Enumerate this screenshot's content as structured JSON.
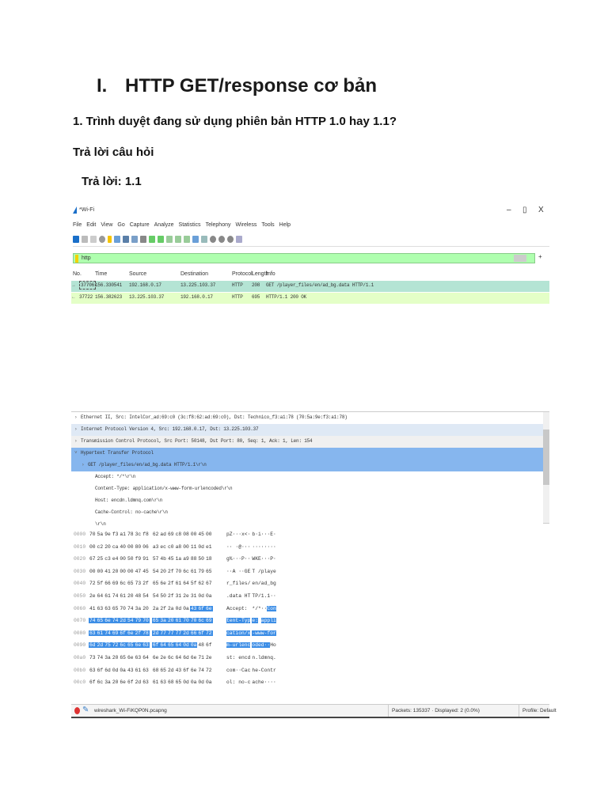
{
  "document": {
    "heading_num": "I.",
    "heading": "HTTP GET/response cơ bản",
    "question": "1. Trình duyệt đang sử dụng phiên bản HTTP 1.0 hay 1.1?",
    "answer_heading": "Trả lời câu hỏi",
    "answer": "Trả lời: 1.1"
  },
  "wireshark": {
    "title": "*Wi-Fi",
    "window_controls": {
      "minimize": "–",
      "restore": "▯",
      "close": "X"
    },
    "menu": [
      "File",
      "Edit",
      "View",
      "Go",
      "Capture",
      "Analyze",
      "Statistics",
      "Telephony",
      "Wireless",
      "Tools",
      "Help"
    ],
    "filter": "http",
    "columns": [
      "No.",
      "Time",
      "Source",
      "Destination",
      "Protocol",
      "Length",
      "Info"
    ],
    "packets": [
      {
        "no": "37706",
        "time": "156.330541",
        "src": "192.168.0.17",
        "dst": "13.225.103.37",
        "proto": "HTTP",
        "len": "208",
        "info": "GET /player_files/en/ad_bg.data HTTP/1.1",
        "color": "#b4e4d4"
      },
      {
        "no": "37722",
        "time": "156.382623",
        "src": "13.225.103.37",
        "dst": "192.168.0.17",
        "proto": "HTTP",
        "len": "695",
        "info": "HTTP/1.1 200 OK",
        "color": "#e4ffc7"
      }
    ],
    "details": [
      {
        "text": "Ethernet II, Src: IntelCor_ad:69:c0 (3c:f8:62:ad:69:c0), Dst: Technico_f3:a1:78 (70:5a:9e:f3:a1:78)",
        "indent": 0,
        "arrow": "›",
        "bg": "#ffffff"
      },
      {
        "text": "Internet Protocol Version 4, Src: 192.168.0.17, Dst: 13.225.103.37",
        "indent": 0,
        "arrow": "›",
        "bg": "#dfe9f5"
      },
      {
        "text": "Transmission Control Protocol, Src Port: 50148, Dst Port: 80, Seq: 1, Ack: 1, Len: 154",
        "indent": 0,
        "arrow": "›",
        "bg": "#f0f0f0"
      },
      {
        "text": "Hypertext Transfer Protocol",
        "indent": 0,
        "arrow": "˅",
        "bg": "#86b6ee"
      },
      {
        "text": "GET /player_files/en/ad_bg.data HTTP/1.1\\r\\n",
        "indent": 1,
        "arrow": "›",
        "bg": "#86b6ee"
      },
      {
        "text": "Accept: */*\\r\\n",
        "indent": 2,
        "arrow": "",
        "bg": "#ffffff"
      },
      {
        "text": "Content-Type: application/x-www-form-urlencoded\\r\\n",
        "indent": 2,
        "arrow": "",
        "bg": "#ffffff"
      },
      {
        "text": "Host: encdn.ldmnq.com\\r\\n",
        "indent": 2,
        "arrow": "",
        "bg": "#ffffff"
      },
      {
        "text": "Cache-Control: no-cache\\r\\n",
        "indent": 2,
        "arrow": "",
        "bg": "#ffffff"
      },
      {
        "text": "\\r\\n",
        "indent": 2,
        "arrow": "",
        "bg": "#ffffff"
      }
    ],
    "hex_rows": [
      {
        "off": "0000",
        "hex": "70 5a 9e f3 a1 78 3c f8 62 ad 69 c8 08 00 45 00",
        "ascii": "pZ···x<· b·i···E·"
      },
      {
        "off": "0010",
        "hex": "00 c2 20 ca 40 00 80 06 a3 ec c0 a8 00 11 0d e1",
        "ascii": "·· ·@··· ········"
      },
      {
        "off": "0020",
        "hex": "67 25 c3 e4 00 50 f9 91 57 4b 45 1a a9 88 50 18",
        "ascii": "g%···P·· WKE···P·"
      },
      {
        "off": "0030",
        "hex": "00 00 41 20 00 00 47 45 54 20 2f 70 6c 61 79 65",
        "ascii": "··A ··GE T /playe"
      },
      {
        "off": "0040",
        "hex": "72 5f 66 69 6c 65 73 2f 65 6e 2f 61 64 5f 62 67",
        "ascii": "r_files/ en/ad_bg"
      },
      {
        "off": "0050",
        "hex": "2e 64 61 74 61 20 48 54 54 50 2f 31 2e 31 0d 0a",
        "ascii": ".data HT TP/1.1··"
      },
      {
        "off": "0060",
        "hex": "41 63 63 65 70 74 3a 20 2a 2f 2a 0d 0a 43 6f 6e",
        "ascii": "Accept:  */*··Con"
      },
      {
        "off": "0070",
        "hex": "74 65 6e 74 2d 54 79 70 65 3a 20 61 70 70 6c 69",
        "ascii": "tent-Typ e: appli"
      },
      {
        "off": "0080",
        "hex": "63 61 74 69 6f 6e 2f 78 2d 77 77 77 2d 66 6f 72",
        "ascii": "cation/x -www-for"
      },
      {
        "off": "0090",
        "hex": "6d 2d 75 72 6c 65 6e 63 6f 64 65 64 0d 0a 48 6f",
        "ascii": "m-urlenc oded··Ho"
      },
      {
        "off": "00a0",
        "hex": "73 74 3a 20 65 6e 63 64 6e 2e 6c 64 6d 6e 71 2e",
        "ascii": "st: encd n.ldmnq."
      },
      {
        "off": "00b0",
        "hex": "63 6f 6d 0d 0a 43 61 63 68 65 2d 43 6f 6e 74 72",
        "ascii": "com··Cac he-Contr"
      },
      {
        "off": "00c0",
        "hex": "6f 6c 3a 20 6e 6f 2d 63 61 63 68 65 0d 0a 0d 0a",
        "ascii": "ol: no-c ache····"
      }
    ],
    "selected_bytes": [
      109,
      157
    ],
    "status": {
      "file": "wireshark_Wi-FiKQP0N.pcapng",
      "packets": "Packets: 135337 · Displayed: 2 (0.0%)",
      "profile": "Profile: Default"
    }
  }
}
